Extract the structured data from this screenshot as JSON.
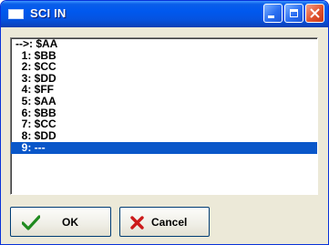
{
  "window": {
    "title": "SCI IN"
  },
  "list": {
    "rows": [
      "-->: $AA",
      "  1: $BB",
      "  2: $CC",
      "  3: $DD",
      "  4: $FF",
      "  5: $AA",
      "  6: $BB",
      "  7: $CC",
      "  8: $DD",
      "  9: ---"
    ],
    "selected_index": 9
  },
  "buttons": {
    "ok_label": "OK",
    "cancel_label": "Cancel"
  },
  "colors": {
    "selection": "#0a57c9",
    "titlebar": "#0058ee",
    "ok_check": "#1f8a1f",
    "cancel_x": "#cc1a1a"
  },
  "icons": {
    "ok": "green-check-icon",
    "cancel": "red-x-icon"
  }
}
